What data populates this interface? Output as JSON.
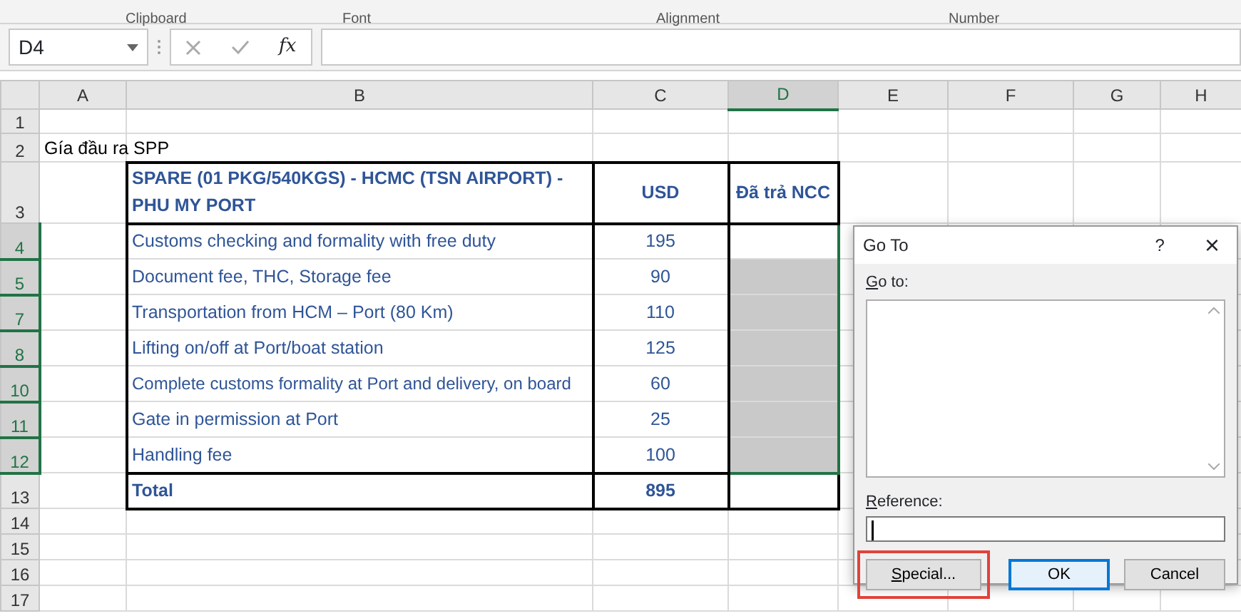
{
  "ribbon_groups": [
    "Clipboard",
    "Font",
    "Alignment",
    "Number"
  ],
  "name_box": {
    "value": "D4"
  },
  "formula_bar": {
    "fx": "fx"
  },
  "columns": [
    {
      "label": "A",
      "selected": false
    },
    {
      "label": "B",
      "selected": false
    },
    {
      "label": "C",
      "selected": false
    },
    {
      "label": "D",
      "selected": true
    },
    {
      "label": "E",
      "selected": false
    },
    {
      "label": "F",
      "selected": false
    },
    {
      "label": "G",
      "selected": false
    },
    {
      "label": "H",
      "selected": false
    }
  ],
  "rows": [
    {
      "label": "1",
      "selected": false,
      "kind": "blank"
    },
    {
      "label": "2",
      "selected": false,
      "kind": "title",
      "text": "Gía đầu ra SPP"
    },
    {
      "label": "3",
      "selected": false,
      "kind": "header",
      "item": "SPARE (01 PKG/540KGS) - HCMC (TSN AIRPORT) - PHU MY PORT",
      "usd": "USD",
      "paid": "Đã trả NCC"
    },
    {
      "label": "4",
      "selected": true,
      "kind": "item",
      "item": "Customs checking and formality with free duty",
      "usd": "195",
      "shaded": false
    },
    {
      "label": "5",
      "selected": true,
      "kind": "item",
      "item": "Document fee, THC, Storage fee",
      "usd": "90",
      "shaded": true
    },
    {
      "label": "7",
      "selected": true,
      "kind": "item",
      "item": "Transportation from HCM – Port (80 Km)",
      "usd": "110",
      "shaded": true
    },
    {
      "label": "8",
      "selected": true,
      "kind": "item",
      "item": "Lifting on/off at Port/boat station",
      "usd": "125",
      "shaded": true
    },
    {
      "label": "10",
      "selected": true,
      "kind": "item",
      "item": "Complete customs formality at Port and delivery, on board",
      "usd": "60",
      "shaded": true
    },
    {
      "label": "11",
      "selected": true,
      "kind": "item",
      "item": "Gate in permission at Port",
      "usd": "25",
      "shaded": true
    },
    {
      "label": "12",
      "selected": true,
      "kind": "item",
      "item": "Handling fee",
      "usd": "100",
      "shaded": true
    },
    {
      "label": "13",
      "selected": false,
      "kind": "total",
      "item": "Total",
      "usd": "895"
    },
    {
      "label": "14",
      "selected": false,
      "kind": "blank"
    },
    {
      "label": "15",
      "selected": false,
      "kind": "blank"
    },
    {
      "label": "16",
      "selected": false,
      "kind": "blank"
    },
    {
      "label": "17",
      "selected": false,
      "kind": "blank"
    }
  ],
  "dialog": {
    "title": "Go To",
    "help": "?",
    "close": "×",
    "goto_label": "Go to:",
    "reference_label": "Reference:",
    "buttons": [
      {
        "label": "Special...",
        "kind": "plain",
        "highlighted": true
      },
      {
        "label": "OK",
        "kind": "default",
        "highlighted": false
      },
      {
        "label": "Cancel",
        "kind": "plain",
        "highlighted": false
      }
    ]
  }
}
